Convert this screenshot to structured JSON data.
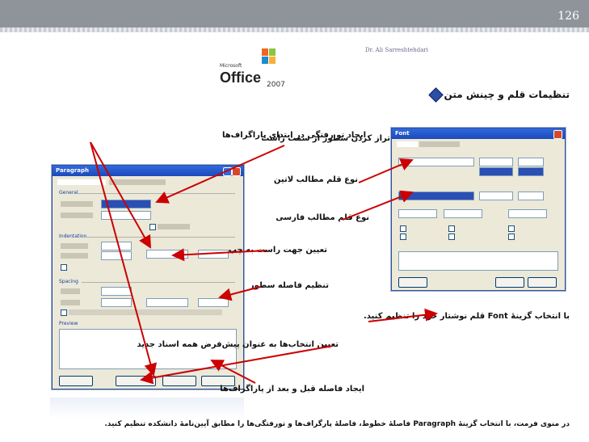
{
  "page_number": "126",
  "author": "Dr. Ali Sarreshtehdari",
  "logo": {
    "small": "Microsoft",
    "word": "Office",
    "year": "2007"
  },
  "title": "تنظیمات قلم و چینش متن",
  "labels": {
    "indent": "ایجاد تو رفتگی در ابتدای پاراگراف‌ها",
    "align_right": "تراز کردن سطور از سمت راست",
    "latin_font": "نوع قلم مطالب لاتین",
    "persian_font": "نوع قلم مطالب فارسی",
    "direction": "تعیین جهت راست به چپ",
    "line_spacing": "تنظیم فاصله سطور",
    "font_instruction": "با انتخاب گزینهٔ  Font قلم نوشتار خود را تنظیم کنید.",
    "set_default": "تعیین انتخاب‌ها به عنوان پیش‌فرض همه اسناد جدید",
    "para_spacing": "ایجاد فاصله قبل و بعد از پاراگراف‌ها"
  },
  "bottom_text": "در منوی فرمت، با انتخاب گزینهٔ Paragraph فاصلهٔ خطوط، فاصلهٔ پارگراف‌ها و تورفتگی‌ها را مطابق آیین‌نامهٔ دانشکده تنظیم کنید.",
  "paragraph_dialog": {
    "title": "Paragraph",
    "sections": [
      "General",
      "Indentation",
      "Spacing",
      "Preview"
    ]
  },
  "font_dialog": {
    "title": "Font"
  },
  "colors": {
    "header": "#8f949b",
    "arrow": "#cc0000",
    "xp_blue": "#2f6ae0"
  },
  "icons": [
    "diamond-bullet-icon",
    "office-logo-icon",
    "close-icon"
  ]
}
